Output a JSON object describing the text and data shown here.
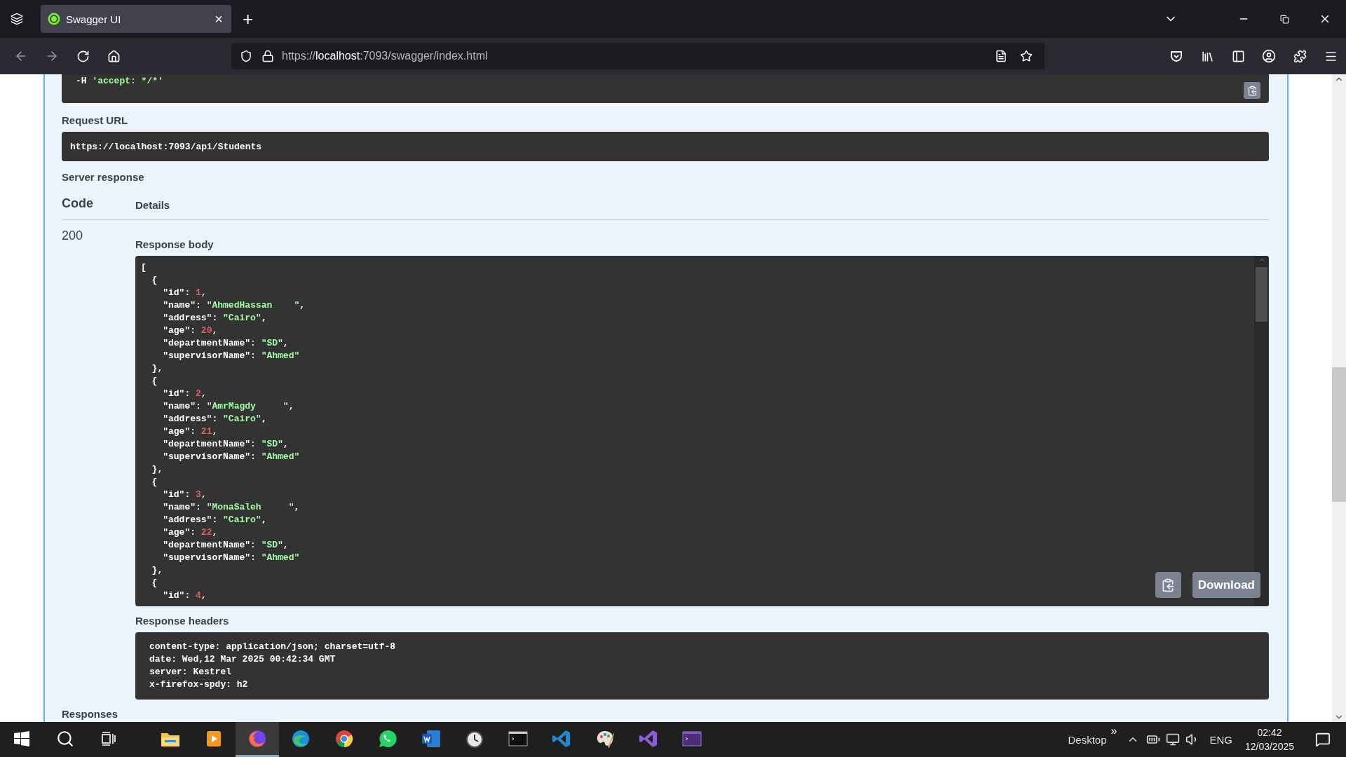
{
  "browser": {
    "tab": {
      "title": "Swagger UI",
      "close": "×"
    },
    "new_tab": "+",
    "url": "https://**localhost**:7093/swagger/index.html"
  },
  "curl": {
    "parts": [
      {
        "text": "-H ",
        "kind": "punct"
      },
      {
        "text": "'accept: */*'",
        "kind": "string"
      }
    ]
  },
  "request_url": {
    "label": "Request URL",
    "value": "https://localhost:7093/api/Students"
  },
  "server_response": {
    "label": "Server response",
    "code_header": "Code",
    "details_header": "Details",
    "code": "200"
  },
  "response_body": {
    "label": "Response body",
    "download": "Download",
    "lines": [
      [
        {
          "text": "[",
          "kind": "punct"
        }
      ],
      [
        {
          "text": "  {",
          "kind": "punct"
        }
      ],
      [
        {
          "text": "    \"id\": ",
          "kind": "punct"
        },
        {
          "text": "1",
          "kind": "number"
        },
        {
          "text": ",",
          "kind": "punct"
        }
      ],
      [
        {
          "text": "    \"name\": ",
          "kind": "punct"
        },
        {
          "text": "\"AhmedHassan    \"",
          "kind": "string"
        },
        {
          "text": ",",
          "kind": "punct"
        }
      ],
      [
        {
          "text": "    \"address\": ",
          "kind": "punct"
        },
        {
          "text": "\"Cairo\"",
          "kind": "string"
        },
        {
          "text": ",",
          "kind": "punct"
        }
      ],
      [
        {
          "text": "    \"age\": ",
          "kind": "punct"
        },
        {
          "text": "20",
          "kind": "number"
        },
        {
          "text": ",",
          "kind": "punct"
        }
      ],
      [
        {
          "text": "    \"departmentName\": ",
          "kind": "punct"
        },
        {
          "text": "\"SD\"",
          "kind": "string"
        },
        {
          "text": ",",
          "kind": "punct"
        }
      ],
      [
        {
          "text": "    \"supervisorName\": ",
          "kind": "punct"
        },
        {
          "text": "\"Ahmed\"",
          "kind": "string"
        }
      ],
      [
        {
          "text": "  },",
          "kind": "punct"
        }
      ],
      [
        {
          "text": "  {",
          "kind": "punct"
        }
      ],
      [
        {
          "text": "    \"id\": ",
          "kind": "punct"
        },
        {
          "text": "2",
          "kind": "number"
        },
        {
          "text": ",",
          "kind": "punct"
        }
      ],
      [
        {
          "text": "    \"name\": ",
          "kind": "punct"
        },
        {
          "text": "\"AmrMagdy     \"",
          "kind": "string"
        },
        {
          "text": ",",
          "kind": "punct"
        }
      ],
      [
        {
          "text": "    \"address\": ",
          "kind": "punct"
        },
        {
          "text": "\"Cairo\"",
          "kind": "string"
        },
        {
          "text": ",",
          "kind": "punct"
        }
      ],
      [
        {
          "text": "    \"age\": ",
          "kind": "punct"
        },
        {
          "text": "21",
          "kind": "number"
        },
        {
          "text": ",",
          "kind": "punct"
        }
      ],
      [
        {
          "text": "    \"departmentName\": ",
          "kind": "punct"
        },
        {
          "text": "\"SD\"",
          "kind": "string"
        },
        {
          "text": ",",
          "kind": "punct"
        }
      ],
      [
        {
          "text": "    \"supervisorName\": ",
          "kind": "punct"
        },
        {
          "text": "\"Ahmed\"",
          "kind": "string"
        }
      ],
      [
        {
          "text": "  },",
          "kind": "punct"
        }
      ],
      [
        {
          "text": "  {",
          "kind": "punct"
        }
      ],
      [
        {
          "text": "    \"id\": ",
          "kind": "punct"
        },
        {
          "text": "3",
          "kind": "number"
        },
        {
          "text": ",",
          "kind": "punct"
        }
      ],
      [
        {
          "text": "    \"name\": ",
          "kind": "punct"
        },
        {
          "text": "\"MonaSaleh     \"",
          "kind": "string"
        },
        {
          "text": ",",
          "kind": "punct"
        }
      ],
      [
        {
          "text": "    \"address\": ",
          "kind": "punct"
        },
        {
          "text": "\"Cairo\"",
          "kind": "string"
        },
        {
          "text": ",",
          "kind": "punct"
        }
      ],
      [
        {
          "text": "    \"age\": ",
          "kind": "punct"
        },
        {
          "text": "22",
          "kind": "number"
        },
        {
          "text": ",",
          "kind": "punct"
        }
      ],
      [
        {
          "text": "    \"departmentName\": ",
          "kind": "punct"
        },
        {
          "text": "\"SD\"",
          "kind": "string"
        },
        {
          "text": ",",
          "kind": "punct"
        }
      ],
      [
        {
          "text": "    \"supervisorName\": ",
          "kind": "punct"
        },
        {
          "text": "\"Ahmed\"",
          "kind": "string"
        }
      ],
      [
        {
          "text": "  },",
          "kind": "punct"
        }
      ],
      [
        {
          "text": "  {",
          "kind": "punct"
        }
      ],
      [
        {
          "text": "    \"id\": ",
          "kind": "punct"
        },
        {
          "text": "4",
          "kind": "number"
        },
        {
          "text": ",",
          "kind": "punct"
        }
      ]
    ]
  },
  "response_headers": {
    "label": "Response headers",
    "lines": [
      "content-type: application/json; charset=utf-8",
      "date: Wed,12 Mar 2025 00:42:34 GMT",
      "server: Kestrel",
      "x-firefox-spdy: h2"
    ]
  },
  "responses_label": "Responses",
  "taskbar": {
    "apps": [
      {
        "kind": "explorer",
        "selected": false
      },
      {
        "kind": "media",
        "selected": false
      },
      {
        "kind": "firefox",
        "selected": true
      },
      {
        "kind": "edge",
        "selected": false
      },
      {
        "kind": "chrome",
        "selected": false
      },
      {
        "kind": "whatsapp",
        "selected": false
      },
      {
        "kind": "word",
        "selected": false
      },
      {
        "kind": "clock",
        "selected": false
      },
      {
        "kind": "terminal",
        "selected": false
      },
      {
        "kind": "vscode",
        "selected": false
      },
      {
        "kind": "paint",
        "selected": false
      },
      {
        "kind": "visualstudio",
        "selected": false
      },
      {
        "kind": "console",
        "selected": false
      }
    ],
    "desktop": "Desktop",
    "more": "»",
    "language": "ENG",
    "time": "02:42",
    "date": "12/03/2025"
  }
}
